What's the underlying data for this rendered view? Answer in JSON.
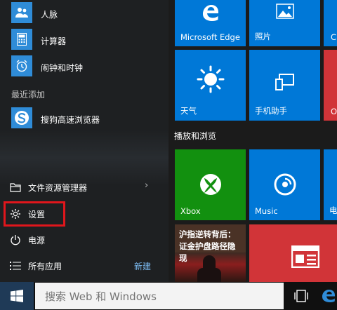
{
  "start_menu": {
    "apps": [
      {
        "label": "人脉",
        "icon": "people-icon"
      },
      {
        "label": "计算器",
        "icon": "calculator-icon"
      },
      {
        "label": "闹钟和时钟",
        "icon": "alarm-clock-icon"
      }
    ],
    "recent_section": "最近添加",
    "recent_apps": [
      {
        "label": "搜狗高速浏览器",
        "icon": "sogou-browser-icon"
      }
    ],
    "system_items": {
      "file_explorer": "文件资源管理器",
      "settings": "设置",
      "power": "电源",
      "all_apps": "所有应用",
      "new_badge": "新建"
    }
  },
  "tiles": {
    "edge": "Microsoft Edge",
    "photos": "照片",
    "partial_top": "C",
    "weather": "天气",
    "phone_companion": "手机助手",
    "partial_mid": "O",
    "group_play": "播放和浏览",
    "xbox": "Xbox",
    "music": "Music",
    "partial_bottom": "电",
    "news_line1": "沪指逆转背后：",
    "news_line2": "证金护盘路径隐",
    "news_line3": "现"
  },
  "taskbar": {
    "search_placeholder": "搜索 Web 和 Windows"
  },
  "colors": {
    "tile_blue": "#0078d7",
    "tile_green": "#12900f",
    "tile_red": "#d13438",
    "highlight": "#e0161c"
  }
}
